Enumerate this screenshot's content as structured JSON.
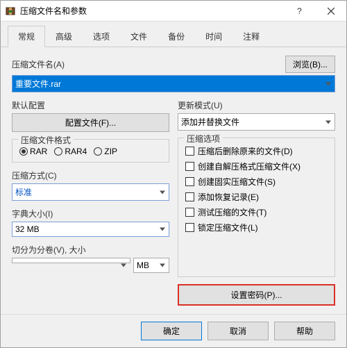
{
  "window": {
    "title": "压缩文件名和参数"
  },
  "tabs": [
    "常规",
    "高级",
    "选项",
    "文件",
    "备份",
    "时间",
    "注释"
  ],
  "filename": {
    "label": "压缩文件名(A)",
    "value": "重要文件.rar",
    "browse": "浏览(B)..."
  },
  "leftCol": {
    "defaultProfile": {
      "label": "默认配置",
      "button": "配置文件(F)..."
    },
    "format": {
      "title": "压缩文件格式",
      "options": [
        "RAR",
        "RAR4",
        "ZIP"
      ],
      "selected": 0
    },
    "method": {
      "label": "压缩方式(C)",
      "value": "标准"
    },
    "dict": {
      "label": "字典大小(I)",
      "value": "32 MB"
    },
    "split": {
      "label": "切分为分卷(V), 大小",
      "size": "",
      "unit": "MB"
    }
  },
  "rightCol": {
    "update": {
      "label": "更新模式(U)",
      "value": "添加并替换文件"
    },
    "options": {
      "title": "压缩选项",
      "items": [
        "压缩后删除原来的文件(D)",
        "创建自解压格式压缩文件(X)",
        "创建固实压缩文件(S)",
        "添加恢复记录(E)",
        "测试压缩的文件(T)",
        "锁定压缩文件(L)"
      ]
    },
    "password": "设置密码(P)..."
  },
  "footer": {
    "ok": "确定",
    "cancel": "取消",
    "help": "帮助"
  }
}
